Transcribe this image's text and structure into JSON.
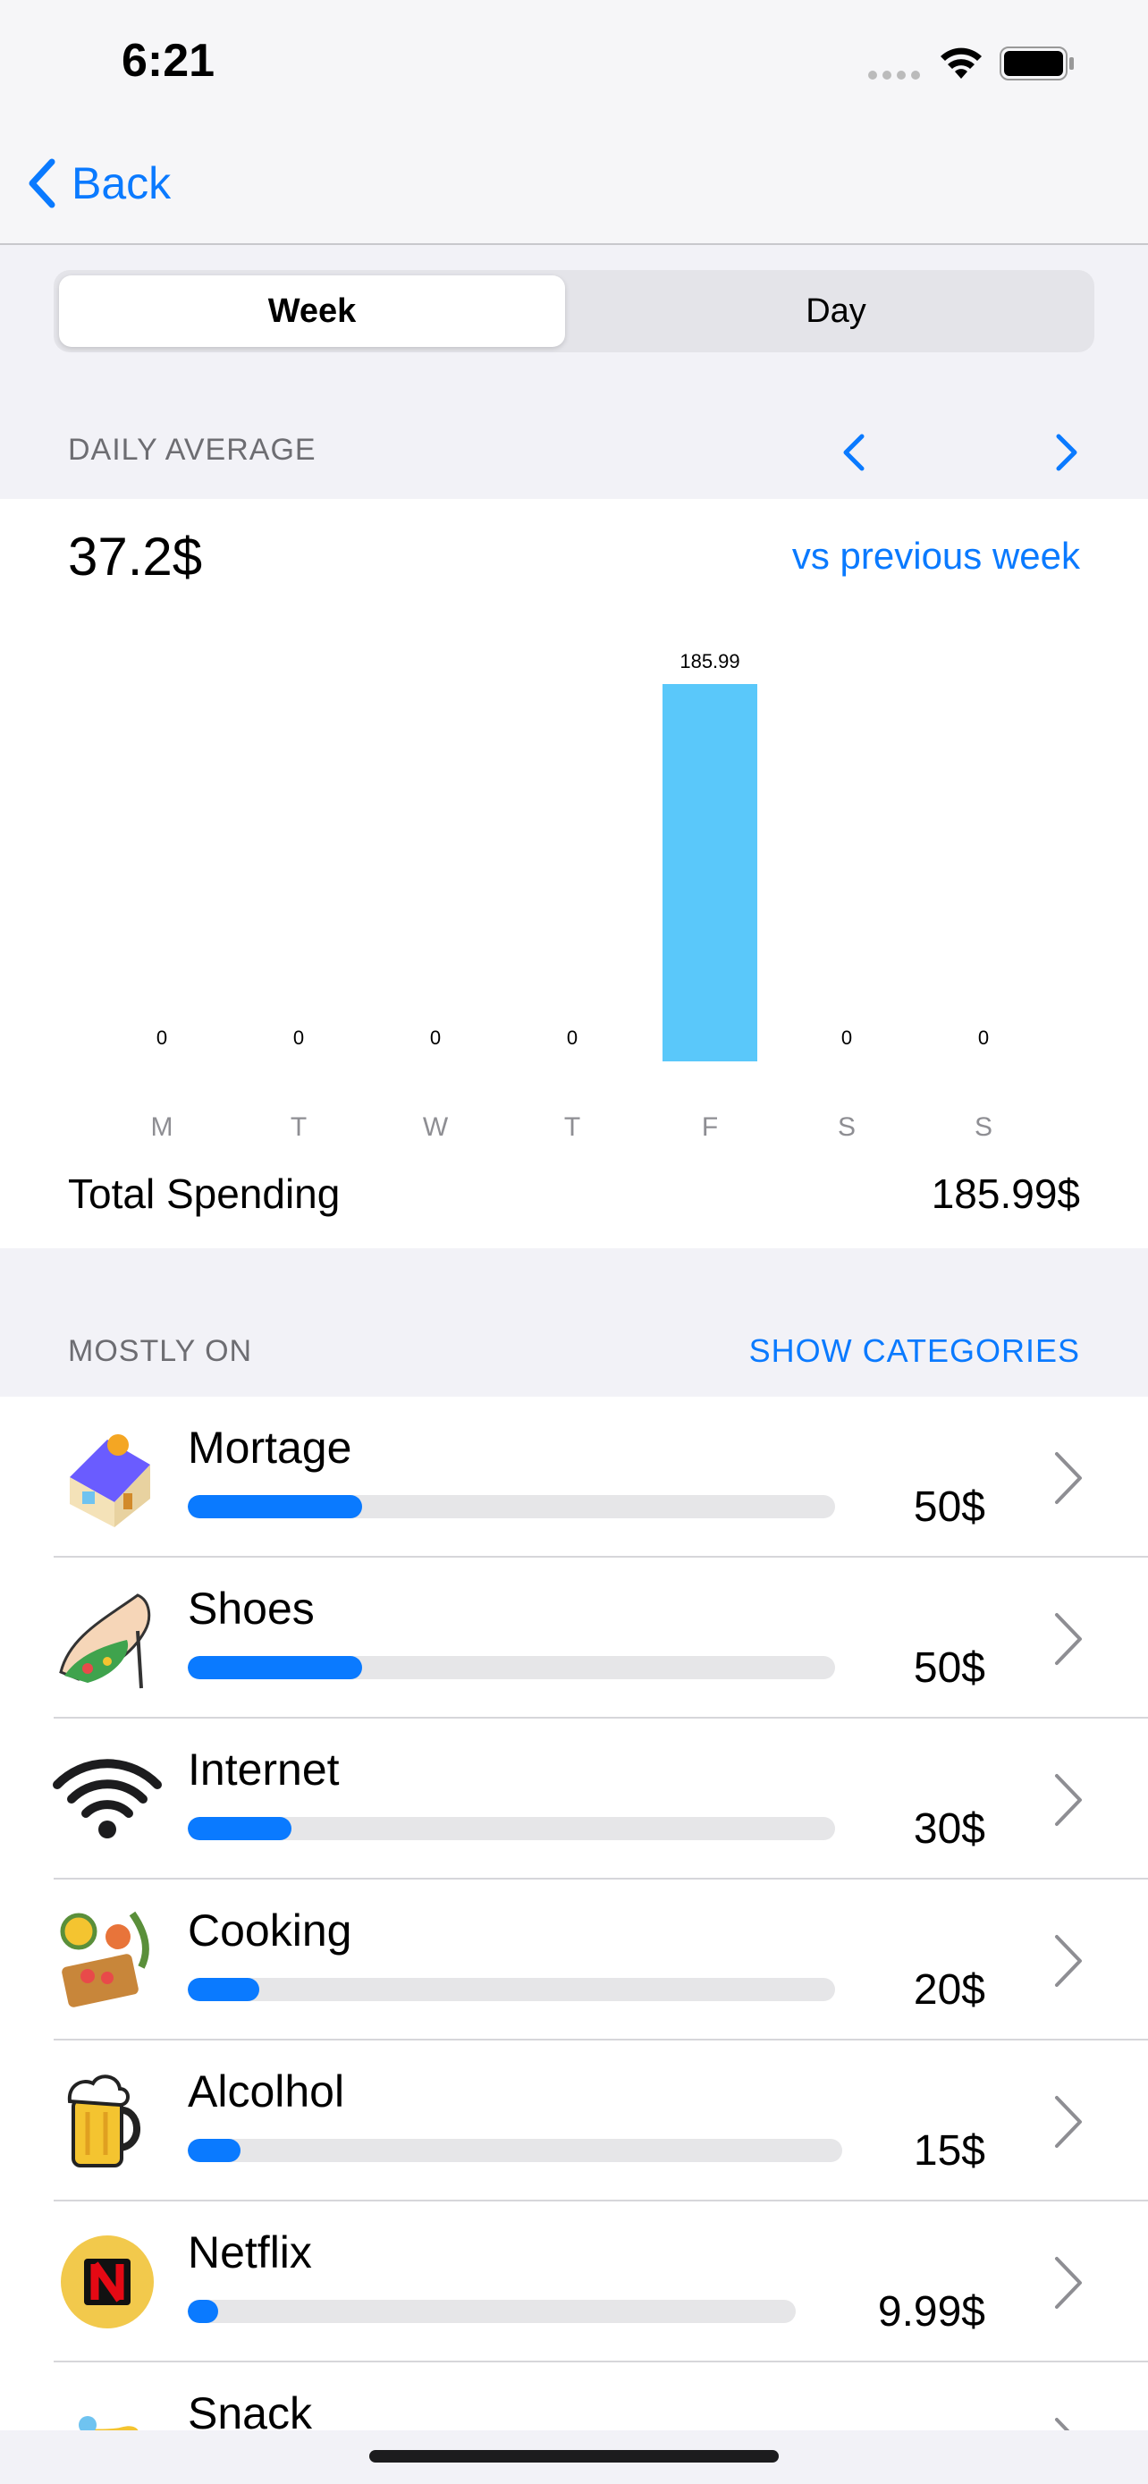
{
  "status_bar": {
    "time": "6:21"
  },
  "nav": {
    "back_label": "Back"
  },
  "segmented": {
    "week": "Week",
    "day": "Day",
    "selected": "Week"
  },
  "daily": {
    "section_label": "DAILY AVERAGE",
    "average": "37.2$",
    "compare_label": "vs previous week"
  },
  "chart_data": {
    "type": "bar",
    "categories": [
      "M",
      "T",
      "W",
      "T",
      "F",
      "S",
      "S"
    ],
    "values": [
      0,
      0,
      0,
      0,
      185.99,
      0,
      0
    ],
    "value_labels": [
      "0",
      "0",
      "0",
      "0",
      "185.99",
      "0",
      "0"
    ],
    "bar_color": "#5ac8fa",
    "ylim": [
      0,
      185.99
    ],
    "grid": false
  },
  "total": {
    "label": "Total Spending",
    "value": "185.99$"
  },
  "mostly": {
    "section_label": "MOSTLY ON",
    "show_categories": "SHOW CATEGORIES"
  },
  "categories": [
    {
      "name": "Mortage",
      "amount": "50$",
      "progress": 0.27,
      "icon": "house-icon"
    },
    {
      "name": "Shoes",
      "amount": "50$",
      "progress": 0.27,
      "icon": "high-heel-shoe-icon"
    },
    {
      "name": "Internet",
      "amount": "30$",
      "progress": 0.16,
      "icon": "wifi-icon"
    },
    {
      "name": "Cooking",
      "amount": "20$",
      "progress": 0.11,
      "icon": "cooking-icon"
    },
    {
      "name": "Alcolhol",
      "amount": "15$",
      "progress": 0.08,
      "icon": "beer-mug-icon"
    },
    {
      "name": "Netflix",
      "amount": "9.99$",
      "progress": 0.05,
      "icon": "netflix-icon"
    },
    {
      "name": "Snack",
      "amount": "",
      "progress": 0,
      "icon": "snack-icon"
    }
  ],
  "colors": {
    "accent": "#0a7aff",
    "bar": "#5ac8fa",
    "progress": "#0a7aff"
  }
}
